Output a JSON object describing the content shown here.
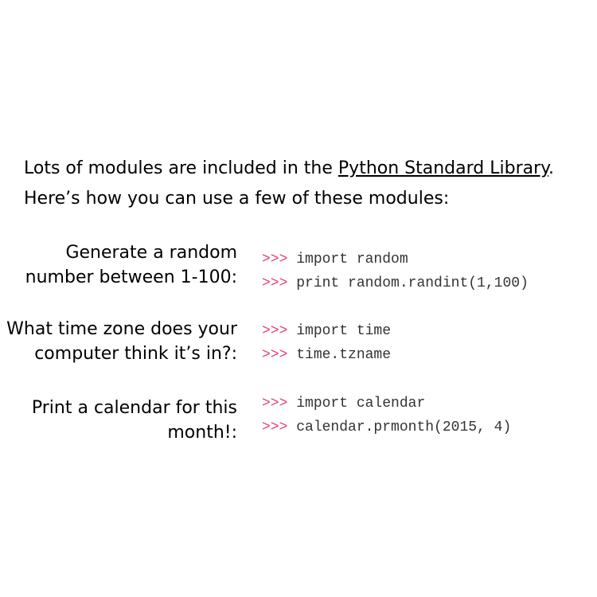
{
  "intro": {
    "line1_prefix": "Lots of modules are included in the ",
    "line1_link": "Python Standard Library",
    "line1_suffix": ".",
    "line2": "Here’s how you can use a few of these modules:"
  },
  "prompt": ">>>",
  "colors": {
    "prompt": "#e0457b",
    "code": "#333333",
    "text": "#000000"
  },
  "examples": [
    {
      "description": [
        "Generate a random",
        "number between 1-100:"
      ],
      "code": [
        "import random",
        "print random.randint(1,100)"
      ]
    },
    {
      "description": [
        "What time zone does your",
        "computer think it’s in?:"
      ],
      "code": [
        "import time",
        "time.tzname"
      ]
    },
    {
      "description": [
        "Print a calendar for this",
        "month!:"
      ],
      "code": [
        "import calendar",
        "calendar.prmonth(2015, 4)"
      ]
    }
  ]
}
